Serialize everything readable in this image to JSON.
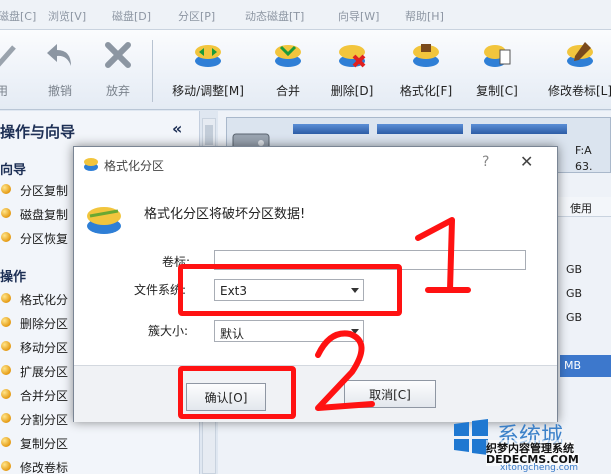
{
  "menu": [
    "磁盘[C]",
    "浏览[V]",
    "磁盘[D]",
    "分区[P]",
    "动态磁盘[T]",
    "向导[W]",
    "帮助[H]"
  ],
  "toolbar": {
    "apply": "用",
    "undo": "撤销",
    "discard": "放弃",
    "move_resize": "移动/调整[M]",
    "merge": "合并",
    "delete": "删除[D]",
    "format": "格式化[F]",
    "copy": "复制[C]",
    "relabel": "修改卷标[L]"
  },
  "left_panel": {
    "title": "操作与向导",
    "collapse": "«",
    "section_wizards": "向导",
    "wizards": [
      "分区复制",
      "磁盘复制",
      "分区恢复"
    ],
    "section_ops": "操作",
    "operations": [
      "格式化分",
      "删除分区",
      "移动分区",
      "扩展分区",
      "合并分区",
      "分割分区",
      "复制分区",
      "修改卷标"
    ]
  },
  "right_panel": {
    "partition_label": "F:A",
    "partition_size": "63.",
    "col_used": "使用",
    "rows": [
      "GB",
      "GB",
      "GB"
    ],
    "selected_row": "MB"
  },
  "dialog": {
    "title": "格式化分区",
    "help": "?",
    "close": "✕",
    "message": "格式化分区将破坏分区数据!",
    "volume_label": "卷标:",
    "volume_value": "",
    "fs_label": "文件系统:",
    "fs_value": "Ext3",
    "cluster_label": "簇大小:",
    "cluster_value": "默认",
    "ok": "确认[O]",
    "cancel": "取消[C]"
  },
  "watermark": {
    "brand": "系统城",
    "line1": "织梦内容管理系统",
    "line2": "DEDECMS.COM",
    "line3": "xitongcheng.com"
  }
}
